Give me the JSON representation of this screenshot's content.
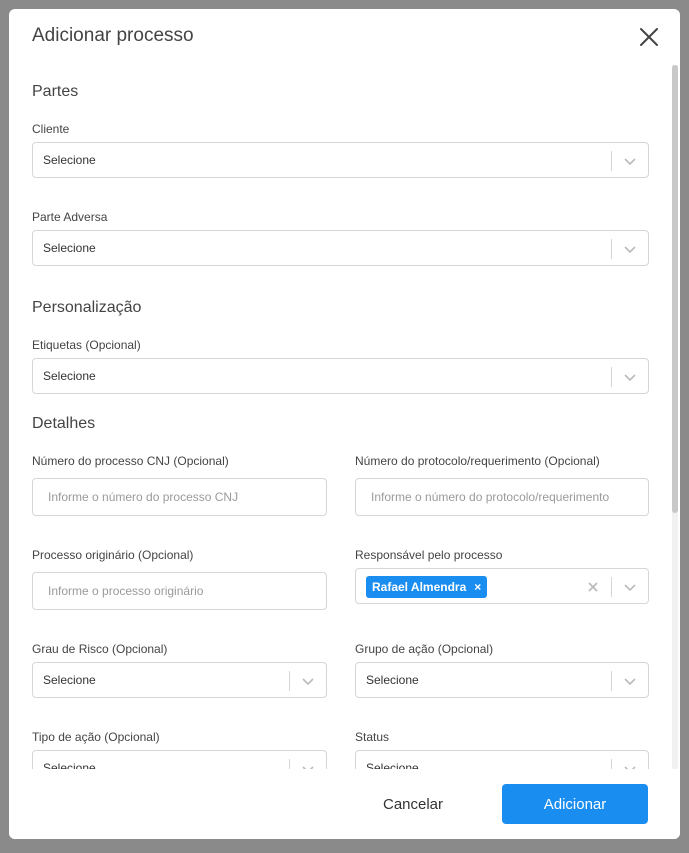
{
  "modal": {
    "title": "Adicionar processo",
    "close_icon": "close-icon"
  },
  "sections": {
    "partes": "Partes",
    "personalizacao": "Personalização",
    "detalhes": "Detalhes"
  },
  "fields": {
    "cliente": {
      "label": "Cliente",
      "value": "Selecione"
    },
    "parte_adversa": {
      "label": "Parte Adversa",
      "value": "Selecione"
    },
    "etiquetas": {
      "label": "Etiquetas (Opcional)",
      "value": "Selecione"
    },
    "numero_cnj": {
      "label": "Número do processo CNJ (Opcional)",
      "placeholder": "Informe o número do processo CNJ"
    },
    "numero_protocolo": {
      "label": "Número do protocolo/requerimento (Opcional)",
      "placeholder": "Informe o número do protocolo/requerimento"
    },
    "processo_originario": {
      "label": "Processo originário (Opcional)",
      "placeholder": "Informe o processo originário"
    },
    "responsavel": {
      "label": "Responsável pelo processo",
      "chip": "Rafael Almendra",
      "chip_remove": "×"
    },
    "grau_risco": {
      "label": "Grau de Risco (Opcional)",
      "value": "Selecione"
    },
    "grupo_acao": {
      "label": "Grupo de ação (Opcional)",
      "value": "Selecione"
    },
    "tipo_acao": {
      "label": "Tipo de ação (Opcional)",
      "value": "Selecione"
    },
    "status": {
      "label": "Status",
      "value": "Selecione"
    }
  },
  "footer": {
    "cancel_label": "Cancelar",
    "add_label": "Adicionar"
  },
  "colors": {
    "accent": "#1a8df0",
    "border": "#d6d6d6",
    "overlay": "#8a8a8a"
  }
}
